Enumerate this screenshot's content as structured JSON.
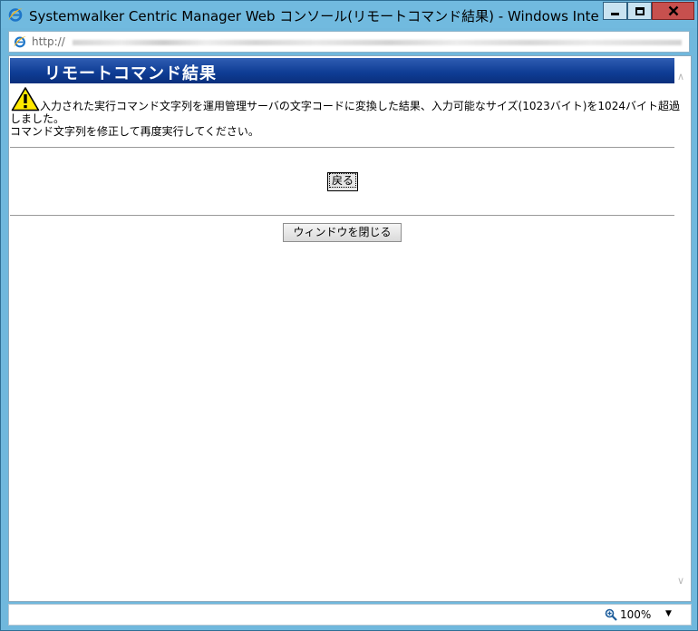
{
  "window": {
    "title": "Systemwalker Centric Manager Web コンソール(リモートコマンド結果) - Windows Internet E..."
  },
  "address": {
    "text": "http://"
  },
  "page": {
    "header_title": "リモートコマンド結果",
    "message_line1": "入力された実行コマンド文字列を運用管理サーバの文字コードに変換した結果、入力可能なサイズ(1023バイト)を1024バイト超過",
    "message_line1_cont": "しました。",
    "message_line2": "コマンド文字列を修正して再度実行してください。",
    "back_button": "戻る",
    "close_window_button": "ウィンドウを閉じる"
  },
  "status": {
    "zoom": "100%"
  },
  "colors": {
    "frame": "#70b8dd",
    "header_bg": "#0e3c93",
    "close_button": "#c7504e"
  }
}
